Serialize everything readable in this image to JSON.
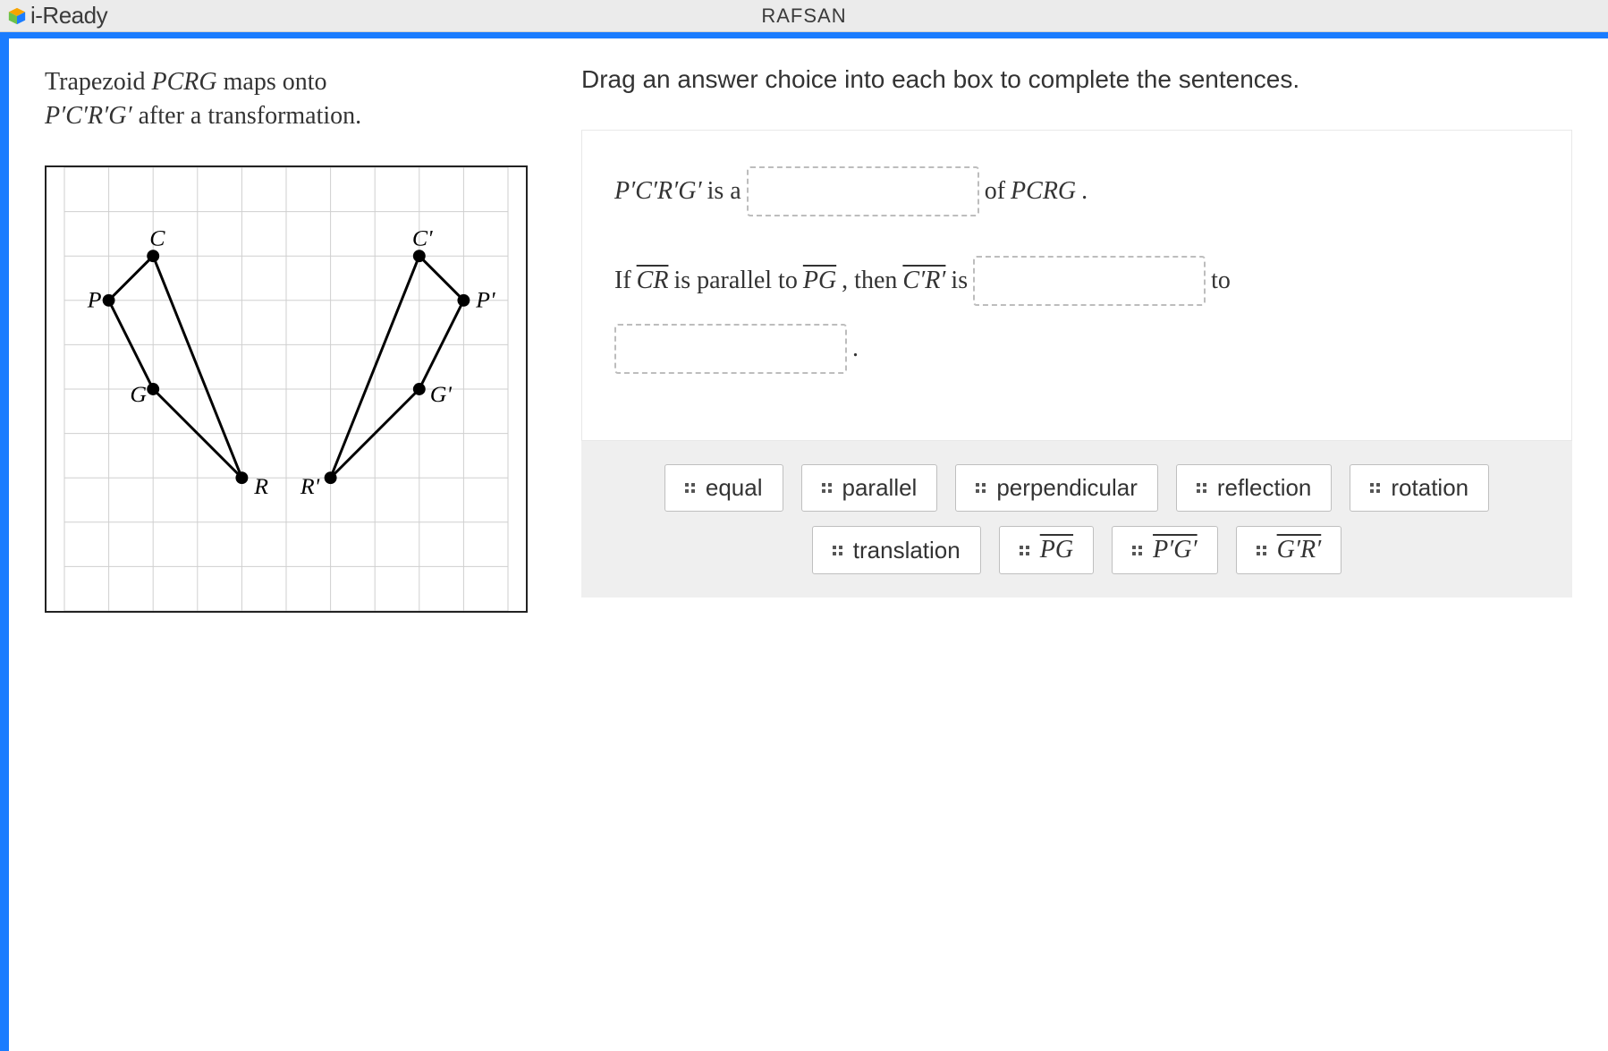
{
  "header": {
    "brand": "i-Ready",
    "student": "RAFSAN"
  },
  "left": {
    "prompt_prefix": "Trapezoid ",
    "prompt_shape": "PCRG",
    "prompt_mid": " maps onto ",
    "prompt_image": "P′C′R′G′",
    "prompt_suffix": " after a transformation."
  },
  "right": {
    "instruction": "Drag an answer choice into each box to complete the sentences.",
    "s1_a": "P′C′R′G′",
    "s1_b": " is a ",
    "s1_c": " of ",
    "s1_d": "PCRG",
    "s1_e": ".",
    "s2_a": "If ",
    "s2_cr": "CR",
    "s2_b": " is parallel to ",
    "s2_pg": "PG",
    "s2_c": " , then ",
    "s2_crp": "C′R′",
    "s2_d": "  is ",
    "s2_e": " to",
    "s2_f": "."
  },
  "choices": {
    "equal": "equal",
    "parallel": "parallel",
    "perpendicular": "perpendicular",
    "reflection": "reflection",
    "rotation": "rotation",
    "translation": "translation",
    "pg": "PG",
    "pigi": "P′G′",
    "giri": "G′R′"
  },
  "chart_data": {
    "type": "diagram",
    "description": "Coordinate grid with trapezoid PCRG and its image P'C'R'G'",
    "grid": {
      "cols": 10,
      "rows": 10,
      "cell": 50
    },
    "labels": [
      "P",
      "C",
      "R",
      "G",
      "P'",
      "C'",
      "R'",
      "G'"
    ],
    "points": {
      "P": [
        1,
        3
      ],
      "C": [
        2,
        2
      ],
      "R": [
        4,
        7
      ],
      "G": [
        2,
        5
      ],
      "P'": [
        9,
        3
      ],
      "C'": [
        8,
        2
      ],
      "R'": [
        6,
        7
      ],
      "G'": [
        8,
        5
      ]
    },
    "shapes": [
      {
        "name": "PCRG",
        "vertices": [
          "P",
          "C",
          "R",
          "G"
        ]
      },
      {
        "name": "P'C'R'G'",
        "vertices": [
          "P'",
          "C'",
          "R'",
          "G'"
        ]
      }
    ]
  }
}
